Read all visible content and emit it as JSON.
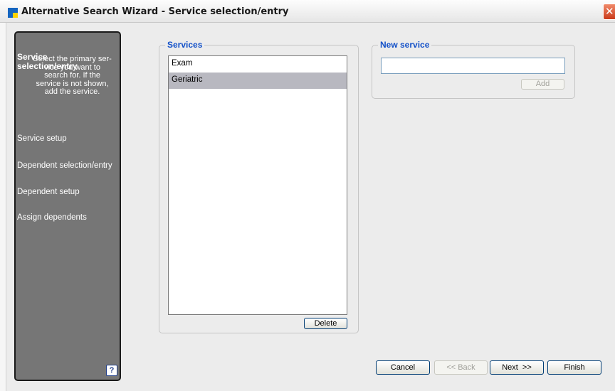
{
  "window": {
    "title": "Alternative Search Wizard - Service selection/entry",
    "close_glyph": "✕"
  },
  "sidebar": {
    "active_title": "Service\nselection/entry",
    "active_description": "Select the primary ser-\nvice you want to\nsearch for. If the\nservice is not shown,\nadd the service.",
    "items": [
      {
        "label": "Service setup"
      },
      {
        "label": "Dependent selection/entry"
      },
      {
        "label": "Dependent setup"
      },
      {
        "label": "Assign dependents"
      }
    ],
    "help_glyph": "?"
  },
  "services": {
    "label": "Services",
    "items": [
      "Exam",
      "Geriatric"
    ],
    "selected": "Geriatric",
    "delete_label": "Delete"
  },
  "new_service": {
    "label": "New service",
    "value": "",
    "add_label": "Add"
  },
  "footer": {
    "cancel": "Cancel",
    "back": "<< Back",
    "next": "Next  >>",
    "finish": "Finish"
  },
  "colors": {
    "group_label": "#1250c8",
    "sidebar_bg": "#767676",
    "selection": "#b8b8c0"
  }
}
